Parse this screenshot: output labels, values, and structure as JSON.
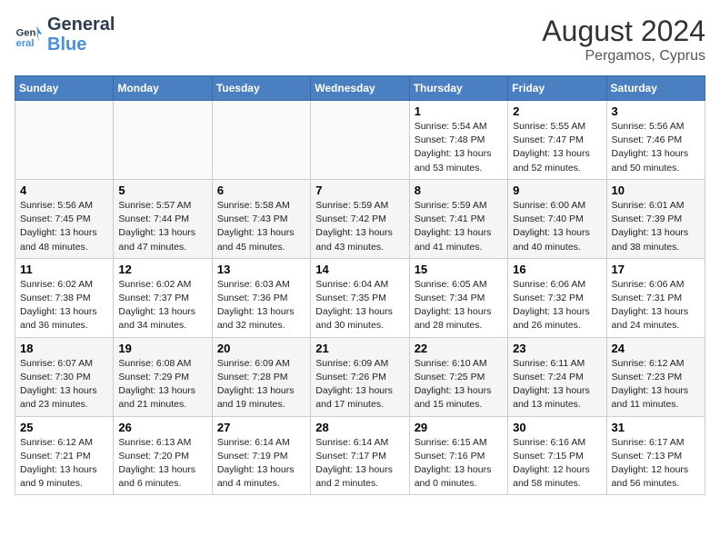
{
  "header": {
    "logo_line1": "General",
    "logo_line2": "Blue",
    "month_year": "August 2024",
    "location": "Pergamos, Cyprus"
  },
  "days_of_week": [
    "Sunday",
    "Monday",
    "Tuesday",
    "Wednesday",
    "Thursday",
    "Friday",
    "Saturday"
  ],
  "weeks": [
    [
      {
        "day": "",
        "content": ""
      },
      {
        "day": "",
        "content": ""
      },
      {
        "day": "",
        "content": ""
      },
      {
        "day": "",
        "content": ""
      },
      {
        "day": "1",
        "content": "Sunrise: 5:54 AM\nSunset: 7:48 PM\nDaylight: 13 hours\nand 53 minutes."
      },
      {
        "day": "2",
        "content": "Sunrise: 5:55 AM\nSunset: 7:47 PM\nDaylight: 13 hours\nand 52 minutes."
      },
      {
        "day": "3",
        "content": "Sunrise: 5:56 AM\nSunset: 7:46 PM\nDaylight: 13 hours\nand 50 minutes."
      }
    ],
    [
      {
        "day": "4",
        "content": "Sunrise: 5:56 AM\nSunset: 7:45 PM\nDaylight: 13 hours\nand 48 minutes."
      },
      {
        "day": "5",
        "content": "Sunrise: 5:57 AM\nSunset: 7:44 PM\nDaylight: 13 hours\nand 47 minutes."
      },
      {
        "day": "6",
        "content": "Sunrise: 5:58 AM\nSunset: 7:43 PM\nDaylight: 13 hours\nand 45 minutes."
      },
      {
        "day": "7",
        "content": "Sunrise: 5:59 AM\nSunset: 7:42 PM\nDaylight: 13 hours\nand 43 minutes."
      },
      {
        "day": "8",
        "content": "Sunrise: 5:59 AM\nSunset: 7:41 PM\nDaylight: 13 hours\nand 41 minutes."
      },
      {
        "day": "9",
        "content": "Sunrise: 6:00 AM\nSunset: 7:40 PM\nDaylight: 13 hours\nand 40 minutes."
      },
      {
        "day": "10",
        "content": "Sunrise: 6:01 AM\nSunset: 7:39 PM\nDaylight: 13 hours\nand 38 minutes."
      }
    ],
    [
      {
        "day": "11",
        "content": "Sunrise: 6:02 AM\nSunset: 7:38 PM\nDaylight: 13 hours\nand 36 minutes."
      },
      {
        "day": "12",
        "content": "Sunrise: 6:02 AM\nSunset: 7:37 PM\nDaylight: 13 hours\nand 34 minutes."
      },
      {
        "day": "13",
        "content": "Sunrise: 6:03 AM\nSunset: 7:36 PM\nDaylight: 13 hours\nand 32 minutes."
      },
      {
        "day": "14",
        "content": "Sunrise: 6:04 AM\nSunset: 7:35 PM\nDaylight: 13 hours\nand 30 minutes."
      },
      {
        "day": "15",
        "content": "Sunrise: 6:05 AM\nSunset: 7:34 PM\nDaylight: 13 hours\nand 28 minutes."
      },
      {
        "day": "16",
        "content": "Sunrise: 6:06 AM\nSunset: 7:32 PM\nDaylight: 13 hours\nand 26 minutes."
      },
      {
        "day": "17",
        "content": "Sunrise: 6:06 AM\nSunset: 7:31 PM\nDaylight: 13 hours\nand 24 minutes."
      }
    ],
    [
      {
        "day": "18",
        "content": "Sunrise: 6:07 AM\nSunset: 7:30 PM\nDaylight: 13 hours\nand 23 minutes."
      },
      {
        "day": "19",
        "content": "Sunrise: 6:08 AM\nSunset: 7:29 PM\nDaylight: 13 hours\nand 21 minutes."
      },
      {
        "day": "20",
        "content": "Sunrise: 6:09 AM\nSunset: 7:28 PM\nDaylight: 13 hours\nand 19 minutes."
      },
      {
        "day": "21",
        "content": "Sunrise: 6:09 AM\nSunset: 7:26 PM\nDaylight: 13 hours\nand 17 minutes."
      },
      {
        "day": "22",
        "content": "Sunrise: 6:10 AM\nSunset: 7:25 PM\nDaylight: 13 hours\nand 15 minutes."
      },
      {
        "day": "23",
        "content": "Sunrise: 6:11 AM\nSunset: 7:24 PM\nDaylight: 13 hours\nand 13 minutes."
      },
      {
        "day": "24",
        "content": "Sunrise: 6:12 AM\nSunset: 7:23 PM\nDaylight: 13 hours\nand 11 minutes."
      }
    ],
    [
      {
        "day": "25",
        "content": "Sunrise: 6:12 AM\nSunset: 7:21 PM\nDaylight: 13 hours\nand 9 minutes."
      },
      {
        "day": "26",
        "content": "Sunrise: 6:13 AM\nSunset: 7:20 PM\nDaylight: 13 hours\nand 6 minutes."
      },
      {
        "day": "27",
        "content": "Sunrise: 6:14 AM\nSunset: 7:19 PM\nDaylight: 13 hours\nand 4 minutes."
      },
      {
        "day": "28",
        "content": "Sunrise: 6:14 AM\nSunset: 7:17 PM\nDaylight: 13 hours\nand 2 minutes."
      },
      {
        "day": "29",
        "content": "Sunrise: 6:15 AM\nSunset: 7:16 PM\nDaylight: 13 hours\nand 0 minutes."
      },
      {
        "day": "30",
        "content": "Sunrise: 6:16 AM\nSunset: 7:15 PM\nDaylight: 12 hours\nand 58 minutes."
      },
      {
        "day": "31",
        "content": "Sunrise: 6:17 AM\nSunset: 7:13 PM\nDaylight: 12 hours\nand 56 minutes."
      }
    ]
  ]
}
